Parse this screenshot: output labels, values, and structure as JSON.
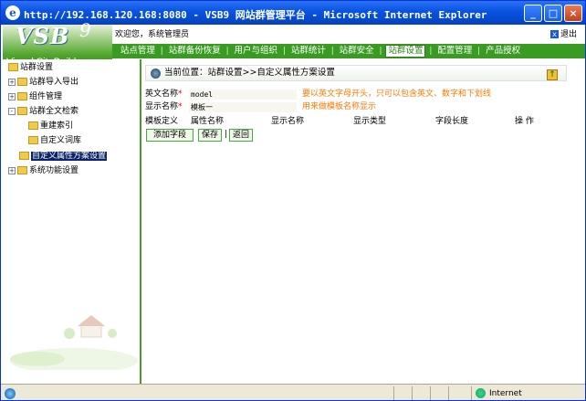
{
  "window": {
    "title": "http://192.168.120.168:8080 - VSB9 网站群管理平台 - Microsoft Internet Explorer",
    "buttons": {
      "minimize": "_",
      "maximize": "□",
      "close": "×"
    }
  },
  "header": {
    "logo_main": "VSB",
    "logo_num": "9",
    "logo_sub": "Visual SiteBuilder",
    "welcome": "欢迎您，系统管理员",
    "logout": "退出"
  },
  "nav": {
    "items": [
      {
        "label": "站点管理"
      },
      {
        "label": "站群备份恢复"
      },
      {
        "label": "用户与组织"
      },
      {
        "label": "站群统计"
      },
      {
        "label": "站群安全"
      },
      {
        "label": "站群设置",
        "active": true
      },
      {
        "label": "配置管理"
      },
      {
        "label": "产品授权"
      }
    ],
    "separator": "|"
  },
  "sidebar": {
    "root": "站群设置",
    "items": [
      {
        "label": "站群导入导出",
        "toggle": "+"
      },
      {
        "label": "组件管理",
        "toggle": "+"
      },
      {
        "label": "站群全文检索",
        "toggle": "-"
      },
      {
        "label": "重建索引"
      },
      {
        "label": "自定义词库"
      },
      {
        "label": "自定义属性方案设置",
        "selected": true
      },
      {
        "label": "系统功能设置",
        "toggle": "+"
      }
    ]
  },
  "main": {
    "breadcrumb": "当前位置：站群设置>>自定义属性方案设置",
    "up_icon": "↑",
    "fields": [
      {
        "label": "英文名称",
        "required": "*",
        "value": "model",
        "hint": "要以英文字母开头，只可以包含英文、数字和下划线"
      },
      {
        "label": "显示名称",
        "required": "*",
        "value": "模板一",
        "hint": "用来做模板名称显示"
      }
    ],
    "columns": [
      "模板定义",
      "属性名称",
      "显示名称",
      "显示类型",
      "字段长度",
      "操 作"
    ],
    "buttons": {
      "add": "添加字段",
      "save": "保存",
      "back": "返回",
      "divider": "|"
    }
  },
  "statusbar": {
    "zone": "Internet"
  },
  "colors": {
    "accent_green": "#3a9b22",
    "title_blue": "#0b55e3",
    "hint_orange": "#ff7800"
  }
}
